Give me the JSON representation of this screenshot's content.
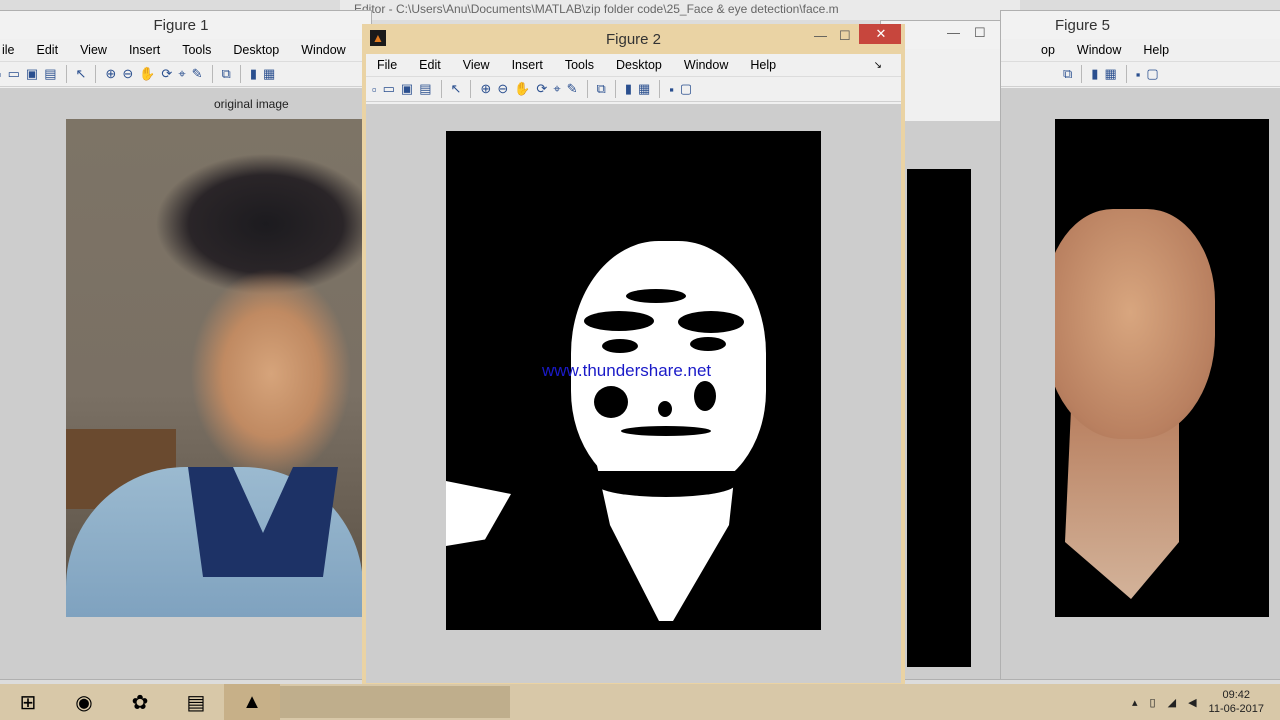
{
  "editor": {
    "title": "Editor - C:\\Users\\Anu\\Documents\\MATLAB\\zip folder code\\25_Face & eye detection\\face.m"
  },
  "figure1": {
    "title": "Figure 1",
    "menu": [
      "ile",
      "Edit",
      "View",
      "Insert",
      "Tools",
      "Desktop",
      "Window",
      "Help"
    ],
    "axis_title": "original image"
  },
  "figure2": {
    "title": "Figure 2",
    "menu": [
      "File",
      "Edit",
      "View",
      "Insert",
      "Tools",
      "Desktop",
      "Window",
      "Help"
    ],
    "watermark": "www.thundershare.net",
    "controls": {
      "minimize": "—",
      "maximize": "☐",
      "close": "✕"
    }
  },
  "figure5": {
    "title": "Figure 5",
    "menu": [
      "op",
      "Window",
      "Help"
    ]
  },
  "toolbar_icons": [
    "new-file-icon",
    "open-folder-icon",
    "save-icon",
    "print-icon",
    "pointer-icon",
    "zoom-in-icon",
    "zoom-out-icon",
    "pan-icon",
    "rotate-icon",
    "data-cursor-icon",
    "brush-icon",
    "link-icon",
    "colorbar-icon",
    "legend-icon",
    "hide-tools-icon",
    "dock-icon"
  ],
  "taskbar": {
    "apps": [
      "start-icon",
      "chrome-icon",
      "paint-icon",
      "explorer-icon",
      "matlab-icon"
    ],
    "time": "09:42",
    "date": "11-06-2017"
  },
  "colors": {
    "active_title": "#ead3a4",
    "close": "#c7463d",
    "taskbar": "#d8c8a8"
  }
}
